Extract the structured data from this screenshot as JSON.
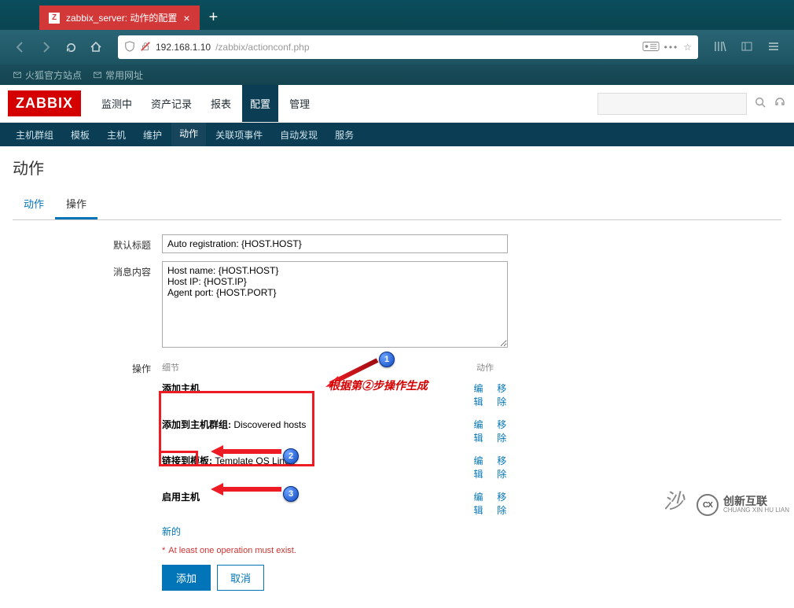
{
  "browser": {
    "tab_title": "zabbix_server: 动作的配置",
    "url_display": "192.168.1.10",
    "url_path": "/zabbix/actionconf.php",
    "bookmarks": [
      "火狐官方站点",
      "常用网址"
    ]
  },
  "zabbix": {
    "logo": "ZABBIX",
    "mainmenu": [
      "监测中",
      "资产记录",
      "报表",
      "配置",
      "管理"
    ],
    "mainmenu_active_idx": 3,
    "submenu": [
      "主机群组",
      "模板",
      "主机",
      "维护",
      "动作",
      "关联项事件",
      "自动发现",
      "服务"
    ],
    "submenu_active_idx": 4,
    "page_title": "动作",
    "tabs": [
      "动作",
      "操作"
    ],
    "tabs_active_idx": 1
  },
  "form": {
    "label_subject": "默认标题",
    "subject_value": "Auto registration: {HOST.HOST}",
    "label_message": "消息内容",
    "message_value": "Host name: {HOST.HOST}\nHost IP: {HOST.IP}\nAgent port: {HOST.PORT}",
    "label_ops": "操作",
    "ops_col_detail": "细节",
    "ops_col_action": "动作",
    "ops_rows": [
      {
        "detail": "添加主机",
        "edit": "编辑",
        "remove": "移除"
      },
      {
        "detail_prefix": "添加到主机群组:",
        "detail_value": " Discovered hosts",
        "edit": "编辑",
        "remove": "移除"
      },
      {
        "detail_prefix": "链接到模板:",
        "detail_value": " Template OS Linux",
        "edit": "编辑",
        "remove": "移除"
      },
      {
        "detail": "启用主机",
        "edit": "编辑",
        "remove": "移除"
      }
    ],
    "new_link": "新的",
    "required_text": "At least one operation must exist.",
    "btn_add": "添加",
    "btn_cancel": "取消"
  },
  "annotations": {
    "note1": "根据第②步操作生成",
    "badge1": "1",
    "badge2": "2",
    "badge3": "3"
  },
  "watermark": {
    "cn": "创新互联",
    "en": "CHUANG XIN HU LIAN",
    "logo": "CX"
  }
}
